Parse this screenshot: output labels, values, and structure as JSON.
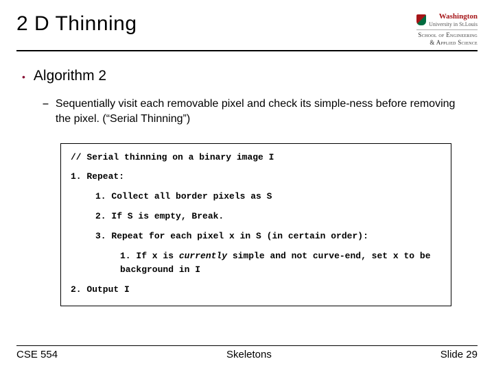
{
  "header": {
    "title": "2 D Thinning",
    "logo": {
      "name": "Washington",
      "sub": "University in St.Louis",
      "school_line1": "School of Engineering",
      "school_line2": "& Applied Science"
    }
  },
  "content": {
    "bullet1": "Algorithm 2",
    "bullet2": "Sequentially visit each removable pixel and check its simple-ness before removing the pixel. (“Serial Thinning”)"
  },
  "code": {
    "l0": "// Serial thinning on a binary image I",
    "l1": "1. Repeat:",
    "l1_1": "1. Collect all border pixels as S",
    "l1_2": "2. If S is empty, Break.",
    "l1_3": "3. Repeat for each pixel x in S (in certain order):",
    "l1_3_1a": "1. If x is ",
    "l1_3_1b": "currently",
    "l1_3_1c": " simple and not curve-end, set x to be background in I",
    "l2": "2. Output I"
  },
  "footer": {
    "left": "CSE 554",
    "center": "Skeletons",
    "right": "Slide 29"
  }
}
